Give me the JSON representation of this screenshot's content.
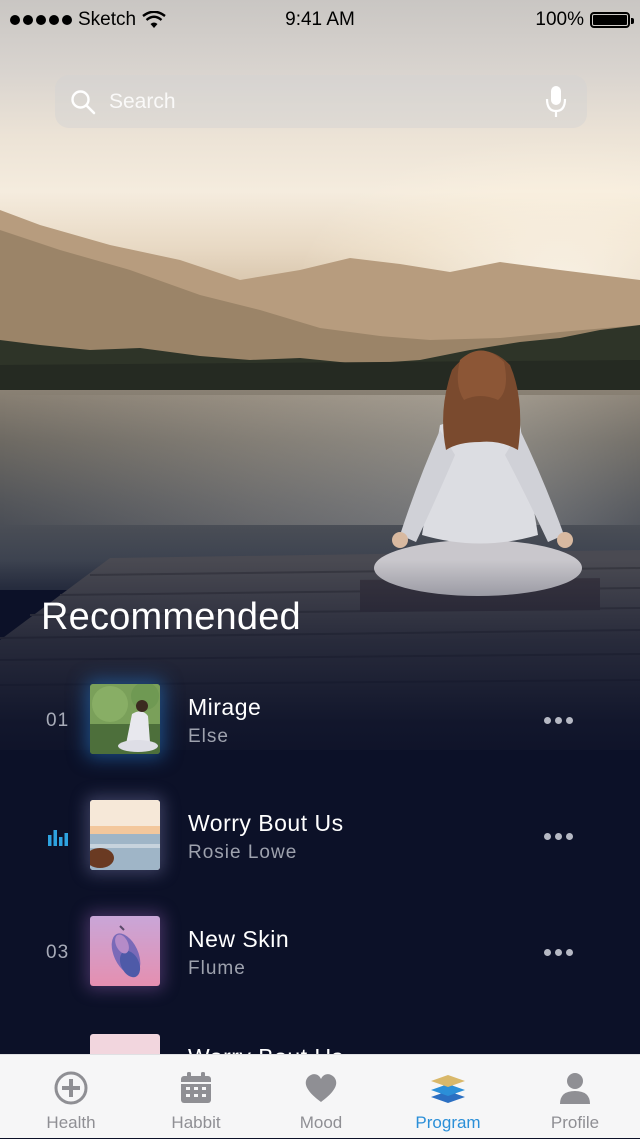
{
  "status_bar": {
    "carrier": "Sketch",
    "time": "9:41 AM",
    "battery": "100%"
  },
  "search": {
    "placeholder": "Search"
  },
  "recommended": {
    "title": "Recommended",
    "tracks": [
      {
        "index": "01",
        "title": "Mirage",
        "artist": "Else",
        "playing": false
      },
      {
        "index": "",
        "title": "Worry Bout Us",
        "artist": "Rosie Lowe",
        "playing": true
      },
      {
        "index": "03",
        "title": "New Skin",
        "artist": "Flume",
        "playing": false
      },
      {
        "index": "",
        "title": "Worry Bout Us",
        "artist": "",
        "playing": false
      }
    ]
  },
  "tab_bar": {
    "tabs": [
      {
        "label": "Health",
        "icon": "plus-circle-icon",
        "active": false
      },
      {
        "label": "Habbit",
        "icon": "calendar-icon",
        "active": false
      },
      {
        "label": "Mood",
        "icon": "heart-icon",
        "active": false
      },
      {
        "label": "Program",
        "icon": "layers-icon",
        "active": true
      },
      {
        "label": "Profile",
        "icon": "person-icon",
        "active": false
      }
    ]
  },
  "colors": {
    "background": "#0c1128",
    "accent": "#2b8fd8",
    "equalizer": "#2ea3e0"
  }
}
